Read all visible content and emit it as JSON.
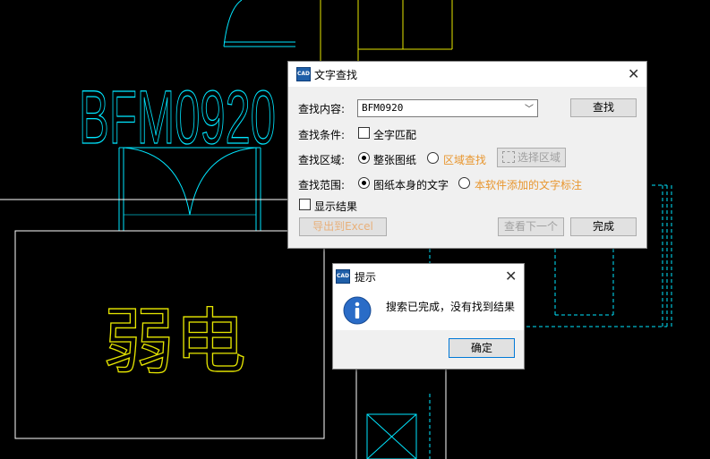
{
  "cad": {
    "drawing_label": "BFM0920",
    "zone_label": "弱电",
    "colors": {
      "cyan": "#00e6ff",
      "yellow": "#e6e600",
      "white": "#ffffff"
    }
  },
  "find_dialog": {
    "title": "文字查找",
    "icon": "app-logo-icon",
    "content_label": "查找内容:",
    "content_value": "BFM0920",
    "find_button": "查找",
    "condition_label": "查找条件:",
    "whole_word": "全字匹配",
    "area_label": "查找区域:",
    "area_whole": "整张图纸",
    "area_region": "区域查找",
    "select_area_button": "选择区域",
    "scope_label": "查找范围:",
    "scope_own": "图纸本身的文字",
    "scope_added": "本软件添加的文字标注",
    "show_results": "显示结果",
    "export_button": "导出到Excel",
    "next_button": "查看下一个",
    "done_button": "完成"
  },
  "prompt_dialog": {
    "title": "提示",
    "message": "搜索已完成，没有找到结果",
    "ok_button": "确定",
    "icon": "info-icon"
  }
}
